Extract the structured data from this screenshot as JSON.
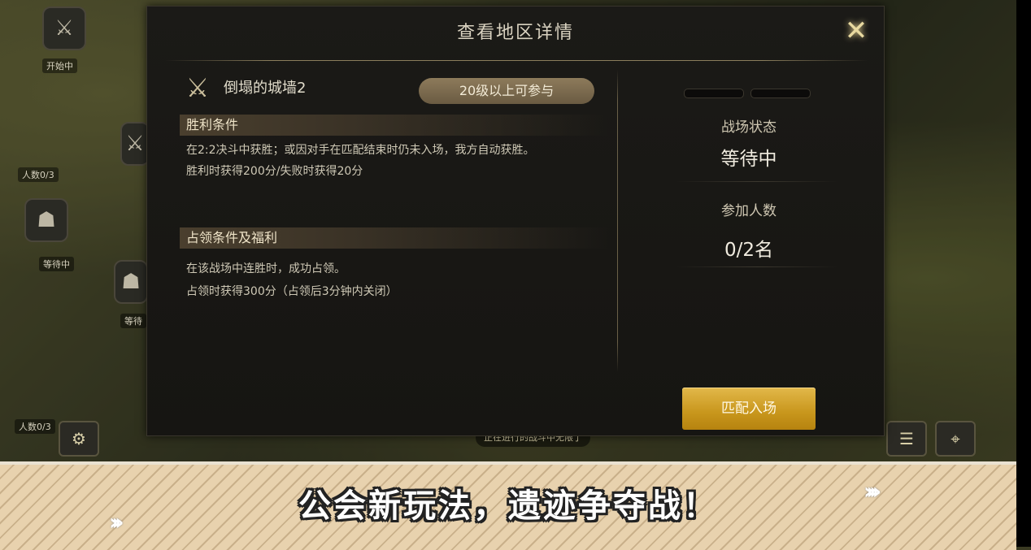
{
  "background": {
    "map_labels": [
      "开始中",
      "人数0/3",
      "等待中",
      "等待",
      "人数0/3"
    ],
    "notice_text": "正在进行的战斗中无限了"
  },
  "dialog": {
    "title": "查看地区详情",
    "close_icon": "close-x-icon",
    "arena": {
      "icon": "crossed-swords-icon",
      "name": "倒塌的城墙2",
      "level_requirement": "20级以上可参与"
    },
    "victory": {
      "heading": "胜利条件",
      "lines": [
        "在2:2决斗中获胜；或因对手在匹配结束时仍未入场，我方自动获胜。",
        "胜利时获得200分/失败时获得20分"
      ]
    },
    "occupation": {
      "heading": "占领条件及福利",
      "lines": [
        "在该战场中连胜时，成功占领。",
        "占领时获得300分（占领后3分钟内关闭）"
      ]
    },
    "status": {
      "battle_state_label": "战场状态",
      "battle_state_value": "等待中",
      "participants_label": "参加人数",
      "participants_value": "0/2名"
    },
    "match_button": "匹配入场"
  },
  "banner": {
    "text": "公会新玩法，遗迹争夺战！",
    "left_chevrons": "›››",
    "right_chevrons": "››››"
  },
  "colors": {
    "accent_gold": "#c8961c",
    "dialog_bg": "#1b1a17",
    "banner_bg": "#e8d2ae"
  }
}
